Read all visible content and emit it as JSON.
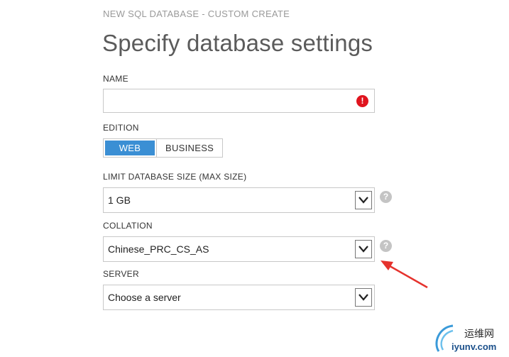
{
  "header": {
    "subtitle": "NEW SQL DATABASE - CUSTOM CREATE",
    "title": "Specify database settings"
  },
  "fields": {
    "name": {
      "label": "NAME",
      "value": "",
      "error_icon": "error-icon"
    },
    "edition": {
      "label": "EDITION",
      "options": [
        "WEB",
        "BUSINESS"
      ],
      "selected": "WEB"
    },
    "size": {
      "label": "LIMIT DATABASE SIZE (MAX SIZE)",
      "value": "1 GB"
    },
    "collation": {
      "label": "COLLATION",
      "value": "Chinese_PRC_CS_AS"
    },
    "server": {
      "label": "SERVER",
      "value": "Choose a server"
    }
  },
  "colors": {
    "accent": "#3b8fd4",
    "error": "#e0141e",
    "arrow": "#e5322d"
  },
  "watermark": {
    "line1": "运维网",
    "line2": "iyunv.com"
  }
}
